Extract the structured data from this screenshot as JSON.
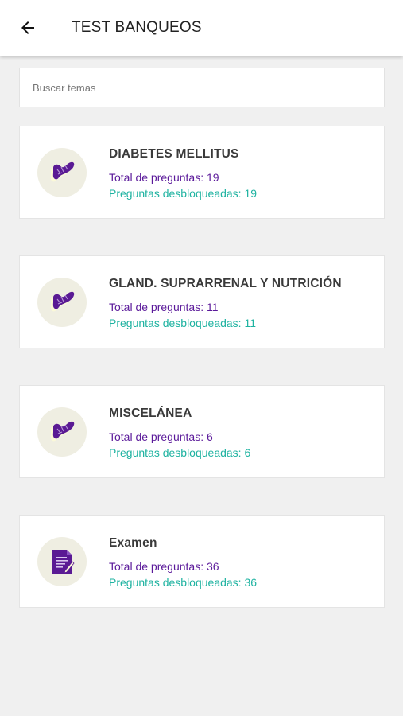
{
  "appbar": {
    "title": "TEST BANQUEOS",
    "back_icon": "arrow-left-icon"
  },
  "search": {
    "placeholder": "Buscar temas",
    "value": ""
  },
  "colors": {
    "total": "#5b1a9a",
    "unlocked": "#1fb3a1",
    "icon_bg": "#efeee2",
    "icon_purple": "#5a1a94"
  },
  "topics": [
    {
      "title": "DIABETES MELLITUS",
      "total": "Total de preguntas: 19",
      "unlocked": "Preguntas desbloqueadas: 19",
      "icon": "pancreas-icon"
    },
    {
      "title": "GLAND. SUPRARRENAL Y NUTRICIÓN",
      "total": "Total de preguntas: 11",
      "unlocked": "Preguntas desbloqueadas: 11",
      "icon": "pancreas-icon"
    },
    {
      "title": "MISCELÁNEA",
      "total": "Total de preguntas: 6",
      "unlocked": "Preguntas desbloqueadas: 6",
      "icon": "pancreas-icon"
    },
    {
      "title": "Examen",
      "total": "Total de preguntas: 36",
      "unlocked": "Preguntas desbloqueadas: 36",
      "icon": "exam-document-icon"
    }
  ]
}
